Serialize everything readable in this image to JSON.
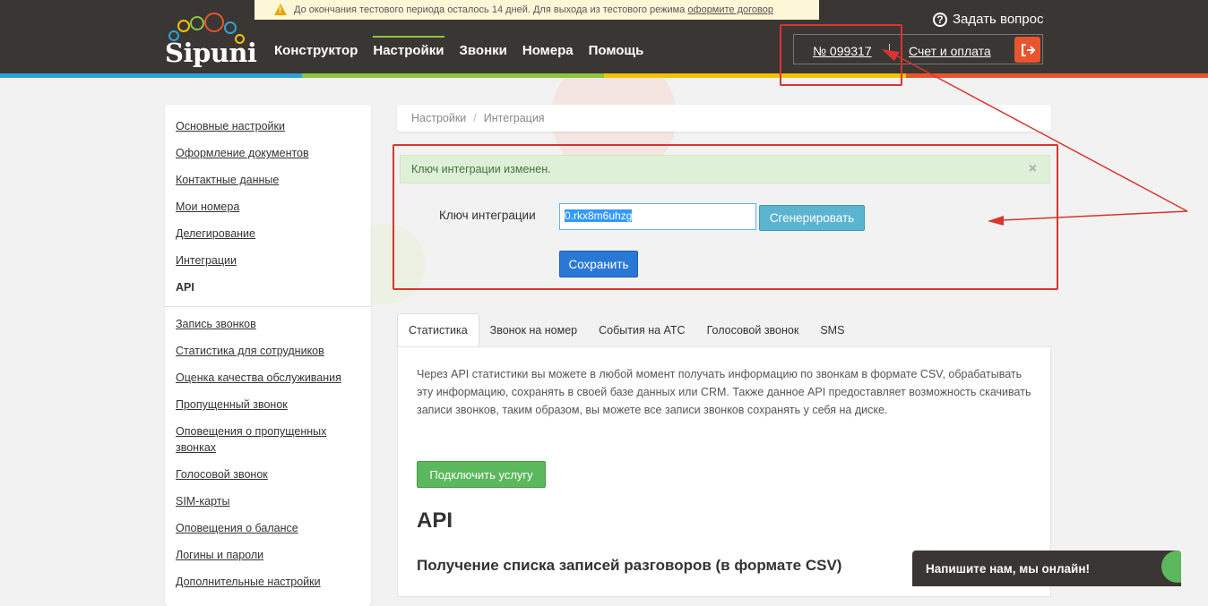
{
  "header": {
    "trial_text": "До окончания тестового периода осталось 14 дней. Для выхода из тестового режима",
    "trial_link": "оформите договор",
    "logo_text": "Sipuni",
    "nav": [
      "Конструктор",
      "Настройки",
      "Звонки",
      "Номера",
      "Помощь"
    ],
    "ask_label": "Задать вопрос",
    "account_number": "№ 099317",
    "billing_label": "Счет и оплата"
  },
  "sidebar": {
    "group1": [
      "Основные настройки",
      "Оформление документов",
      "Контактные данные",
      "Мои номера",
      "Делегирование",
      "Интеграции"
    ],
    "active": "API",
    "group2": [
      "Запись звонков",
      "Статистика для сотрудников",
      "Оценка качества обслуживания",
      "Пропущенный звонок",
      "Оповещения о пропущенных звонках",
      "Голосовой звонок",
      "SIM-карты",
      "Оповещения о балансе",
      "Логины и пароли",
      "Дополнительные настройки"
    ]
  },
  "breadcrumb": [
    "Настройки",
    "/",
    "Интеграция"
  ],
  "alert": {
    "text": "Ключ интеграции изменен.",
    "close": "×"
  },
  "integration": {
    "label": "Ключ интеграции",
    "key_value": "0.rkx8m6uhzg",
    "generate_label": "Сгенерировать",
    "save_label": "Сохранить"
  },
  "tabs": [
    "Статистика",
    "Звонок на номер",
    "События на АТС",
    "Голосовой звонок",
    "SMS"
  ],
  "content": {
    "description": "Через API статистики вы можете в любой момент получать информацию по звонкам в формате CSV, обрабатывать эту информацию, сохранять в своей базе данных или CRM. Также данное API предоставляет возможность скачивать записи звонков, таким образом, вы можете все записи звонков сохранять у себя на диске.",
    "connect_label": "Подключить услугу",
    "api_heading": "API",
    "sub_heading": "Получение списка записей разговоров (в формате CSV)"
  },
  "chat": {
    "label": "Напишите нам, мы онлайн!"
  },
  "colors": {
    "header_bg": "#3a3634",
    "accent_green": "#8cc63f",
    "annotation_red": "#d9352f",
    "save_blue": "#2a78d6",
    "generate_teal": "#5bb4d0",
    "connect_green": "#5cb85c",
    "logout_orange": "#e8542e"
  }
}
